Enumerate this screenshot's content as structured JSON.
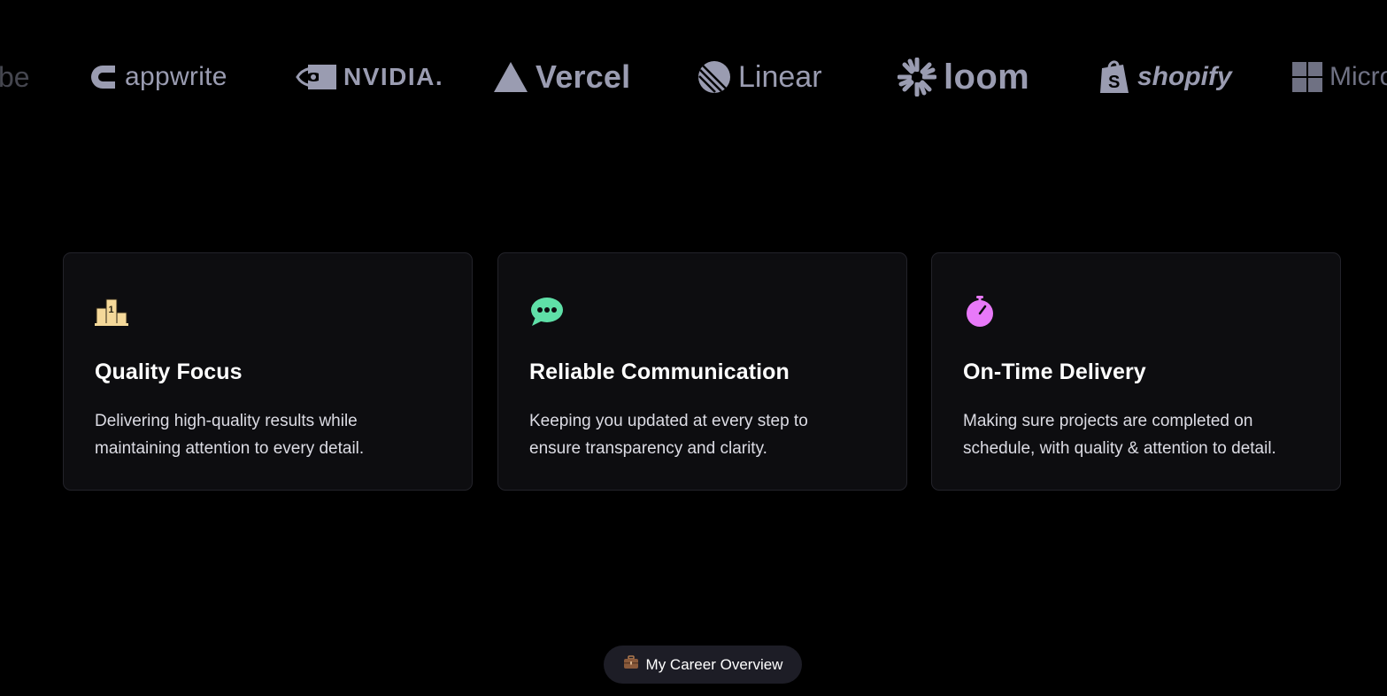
{
  "logos": [
    {
      "name": "youtube",
      "text": "be"
    },
    {
      "name": "appwrite",
      "text": "appwrite"
    },
    {
      "name": "nvidia",
      "text": "NVIDIA."
    },
    {
      "name": "vercel",
      "text": "Vercel"
    },
    {
      "name": "linear",
      "text": "Linear"
    },
    {
      "name": "loom",
      "text": "loom"
    },
    {
      "name": "shopify",
      "text": "shopify"
    },
    {
      "name": "microsoft",
      "text": "Micro"
    }
  ],
  "features": [
    {
      "icon": "podium-icon",
      "title": "Quality Focus",
      "line1": "Delivering high-quality results while",
      "line2": "maintaining attention to every detail."
    },
    {
      "icon": "speech-bubble-icon",
      "title": "Reliable Communication",
      "line1": "Keeping you updated at every step to",
      "line2": "ensure transparency and clarity."
    },
    {
      "icon": "stopwatch-icon",
      "title": "On-Time Delivery",
      "line1": "Making sure projects are completed on",
      "line2": "schedule, with quality & attention to detail."
    }
  ],
  "career_button": {
    "icon": "briefcase-icon",
    "label": "My Career Overview"
  },
  "colors": {
    "background": "#000000",
    "card_bg": "#0d0d10",
    "card_border": "#23232a",
    "logo_gray": "#9a9cb1",
    "pill_bg": "#1d1d26",
    "podium": "#f5d99a",
    "speech": "#5fe0a8",
    "stopwatch": "#e879f9"
  }
}
